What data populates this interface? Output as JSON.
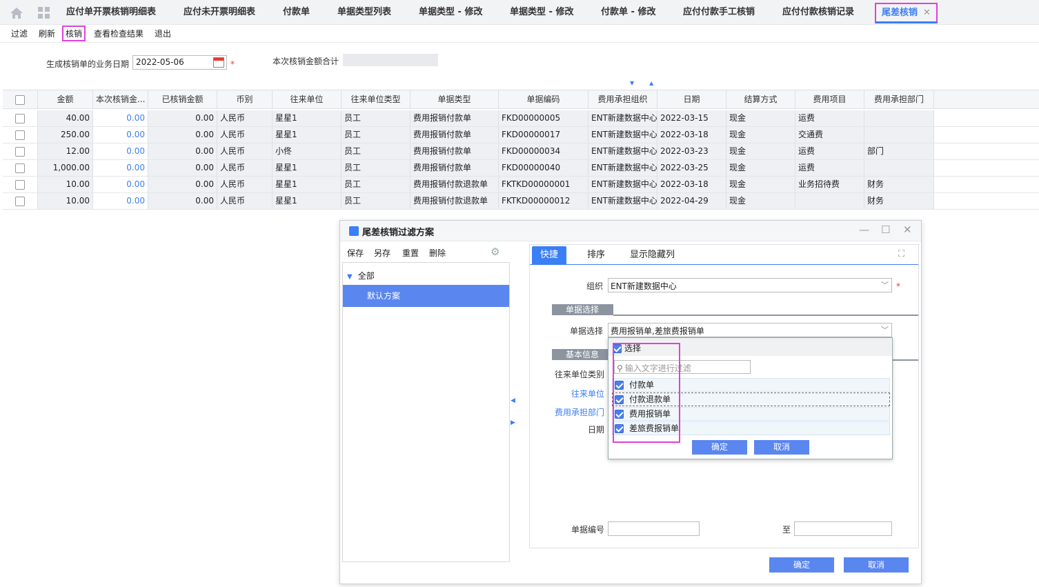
{
  "tabs": [
    "应付单开票核销明细表",
    "应付未开票明细表",
    "付款单",
    "单据类型列表",
    "单据类型 - 修改",
    "单据类型 - 修改",
    "付款单 - 修改",
    "应付付款手工核销",
    "应付付款核销记录"
  ],
  "active_tab": "尾差核销",
  "active_tab_close": "✕",
  "toolbar": [
    "过滤",
    "刷新",
    "核销",
    "查看检查结果",
    "退出"
  ],
  "form": {
    "date_label": "生成核销单的业务日期",
    "date_value": "2022-05-06",
    "required_mark": "*",
    "total_label": "本次核销金额合计"
  },
  "grid": {
    "headers": [
      "金额",
      "本次核销金...",
      "已核销金额",
      "币别",
      "往来单位",
      "往来单位类型",
      "单据类型",
      "单据编码",
      "费用承担组织",
      "日期",
      "结算方式",
      "费用项目",
      "费用承担部门"
    ],
    "rows": [
      [
        "40.00",
        "0.00",
        "0.00",
        "人民币",
        "星星1",
        "员工",
        "费用报销付款单",
        "FKD00000005",
        "ENT新建数据中心",
        "2022-03-15",
        "现金",
        "运费",
        ""
      ],
      [
        "250.00",
        "0.00",
        "0.00",
        "人民币",
        "星星1",
        "员工",
        "费用报销付款单",
        "FKD00000017",
        "ENT新建数据中心",
        "2022-03-18",
        "现金",
        "交通费",
        ""
      ],
      [
        "12.00",
        "0.00",
        "0.00",
        "人民币",
        "小佟",
        "员工",
        "费用报销付款单",
        "FKD00000034",
        "ENT新建数据中心",
        "2022-03-23",
        "现金",
        "运费",
        "部门"
      ],
      [
        "1,000.00",
        "0.00",
        "0.00",
        "人民币",
        "星星1",
        "员工",
        "费用报销付款单",
        "FKD00000040",
        "ENT新建数据中心",
        "2022-03-25",
        "现金",
        "运费",
        ""
      ],
      [
        "10.00",
        "0.00",
        "0.00",
        "人民币",
        "星星1",
        "员工",
        "费用报销付款退款单",
        "FKTKD00000001",
        "ENT新建数据中心",
        "2022-03-18",
        "现金",
        "业务招待费",
        "财务"
      ],
      [
        "10.00",
        "0.00",
        "0.00",
        "人民币",
        "星星1",
        "员工",
        "费用报销付款退款单",
        "FKTKD00000012",
        "ENT新建数据中心",
        "2022-04-29",
        "现金",
        "",
        "财务"
      ]
    ]
  },
  "dialog": {
    "title": "尾差核销过滤方案",
    "scheme_buttons": [
      "保存",
      "另存",
      "重置",
      "删除"
    ],
    "tree_all": "全部",
    "tree_selected": "默认方案",
    "tabs": [
      "快捷",
      "排序",
      "显示隐藏列"
    ],
    "org_label": "组织",
    "org_value": "ENT新建数据中心",
    "section_bill": "单据选择",
    "bill_label": "单据选择",
    "bill_value": "费用报销单,差旅费报销单",
    "section_basic": "基本信息",
    "field_labels": [
      "往来单位类别",
      "往来单位",
      "费用承担部门",
      "日期"
    ],
    "billno_label": "单据编号",
    "to_label": "至",
    "ok": "确定",
    "cancel": "取消"
  },
  "popup": {
    "select_all": "选择",
    "search_placeholder": "输入文字进行过滤",
    "items": [
      "付款单",
      "付款退款单",
      "费用报销单",
      "差旅费报销单"
    ],
    "ok": "确定",
    "cancel": "取消"
  },
  "colors": {
    "accent": "#3b7ff5",
    "highlight": "#e23fd8",
    "button": "#5a86f0"
  }
}
